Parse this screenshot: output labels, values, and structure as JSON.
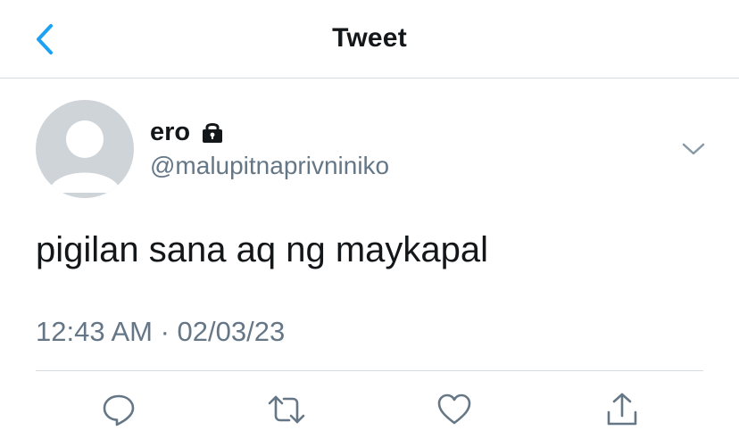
{
  "header": {
    "title": "Tweet",
    "back_icon": "chevron-left-icon",
    "accent_color": "#1da1f2"
  },
  "tweet": {
    "display_name": "ero",
    "protected_icon": "lock-icon",
    "handle": "@malupitnaprivniniko",
    "text": "pigilan sana aq ng maykapal",
    "timestamp": "12:43 AM · 02/03/23",
    "menu_icon": "chevron-down-icon"
  },
  "actions": [
    {
      "name": "reply",
      "icon": "reply-icon"
    },
    {
      "name": "retweet",
      "icon": "retweet-icon"
    },
    {
      "name": "like",
      "icon": "heart-icon"
    },
    {
      "name": "share",
      "icon": "share-icon"
    }
  ],
  "colors": {
    "primary_text": "#14171a",
    "secondary_text": "#657786",
    "border": "#d6dbdf",
    "avatar_bg": "#cfd4d9"
  }
}
